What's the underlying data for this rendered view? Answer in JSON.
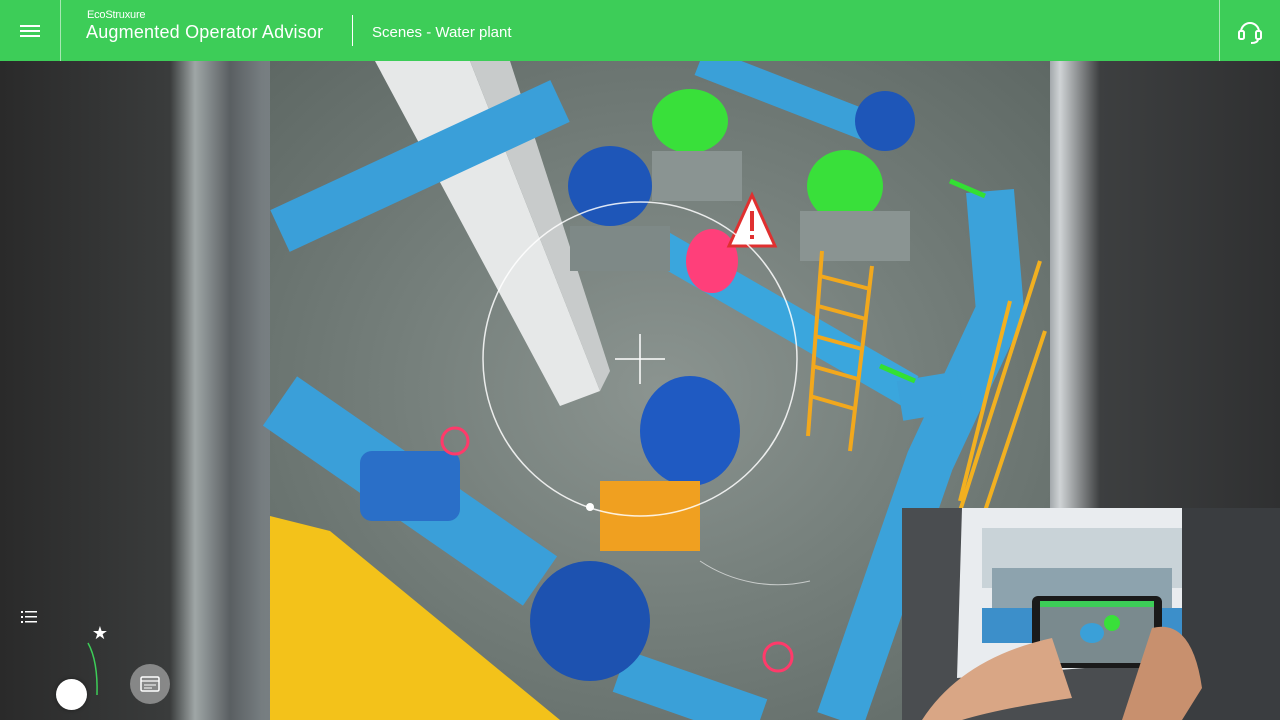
{
  "header": {
    "brand": "EcoStruxure",
    "app_title": "Augmented Operator Advisor",
    "scene_title": "Scenes - Water plant"
  },
  "icons": {
    "menu": "hamburger-menu-icon",
    "support": "headset-support-icon",
    "list": "list-icon",
    "favorite": "star-icon",
    "document": "document-icon",
    "warning": "warning-triangle-icon",
    "crosshair": "crosshair-icon"
  },
  "colors": {
    "brand_green": "#3dcd58",
    "pipe_blue": "#3aa0d8",
    "motor_green": "#33dd33",
    "alert_pink": "#ff3f7a",
    "ladder_yellow": "#f2a81d"
  }
}
